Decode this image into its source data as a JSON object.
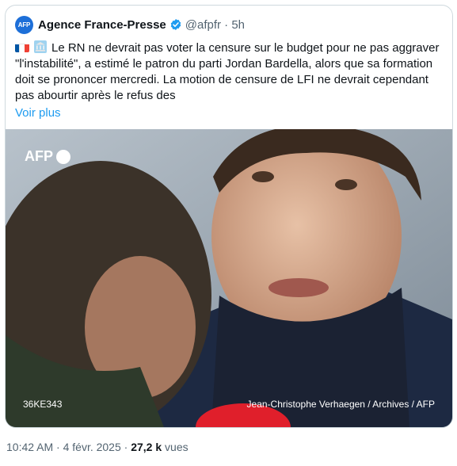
{
  "tweet": {
    "avatar_text": "AFP",
    "author_name": "Agence France-Presse",
    "handle_time": "@afpfr · 5h",
    "text": "Le RN ne devrait pas voter la censure sur le budget pour ne pas aggraver \"l'instabilité\", a estimé le patron du parti Jordan Bardella, alors que sa formation doit se prononcer mercredi. La motion de censure de LFI ne devrait cependant pas abourtir après le refus des",
    "show_more": "Voir plus",
    "icons": [
      "flag-france-icon",
      "bank-icon",
      "verified-badge-icon"
    ]
  },
  "media": {
    "logo_text": "AFP",
    "image_code": "36KE343",
    "credit": "Jean-Christophe Verhaegen / Archives / AFP"
  },
  "meta": {
    "time_date": "10:42 AM · 4 févr. 2025 · ",
    "views_count": "27,2 k",
    "views_label": " vues"
  },
  "colors": {
    "link": "#1d9bf0",
    "secondary": "#536471",
    "verified": "#1d9bf0",
    "border": "#cfd9de"
  }
}
